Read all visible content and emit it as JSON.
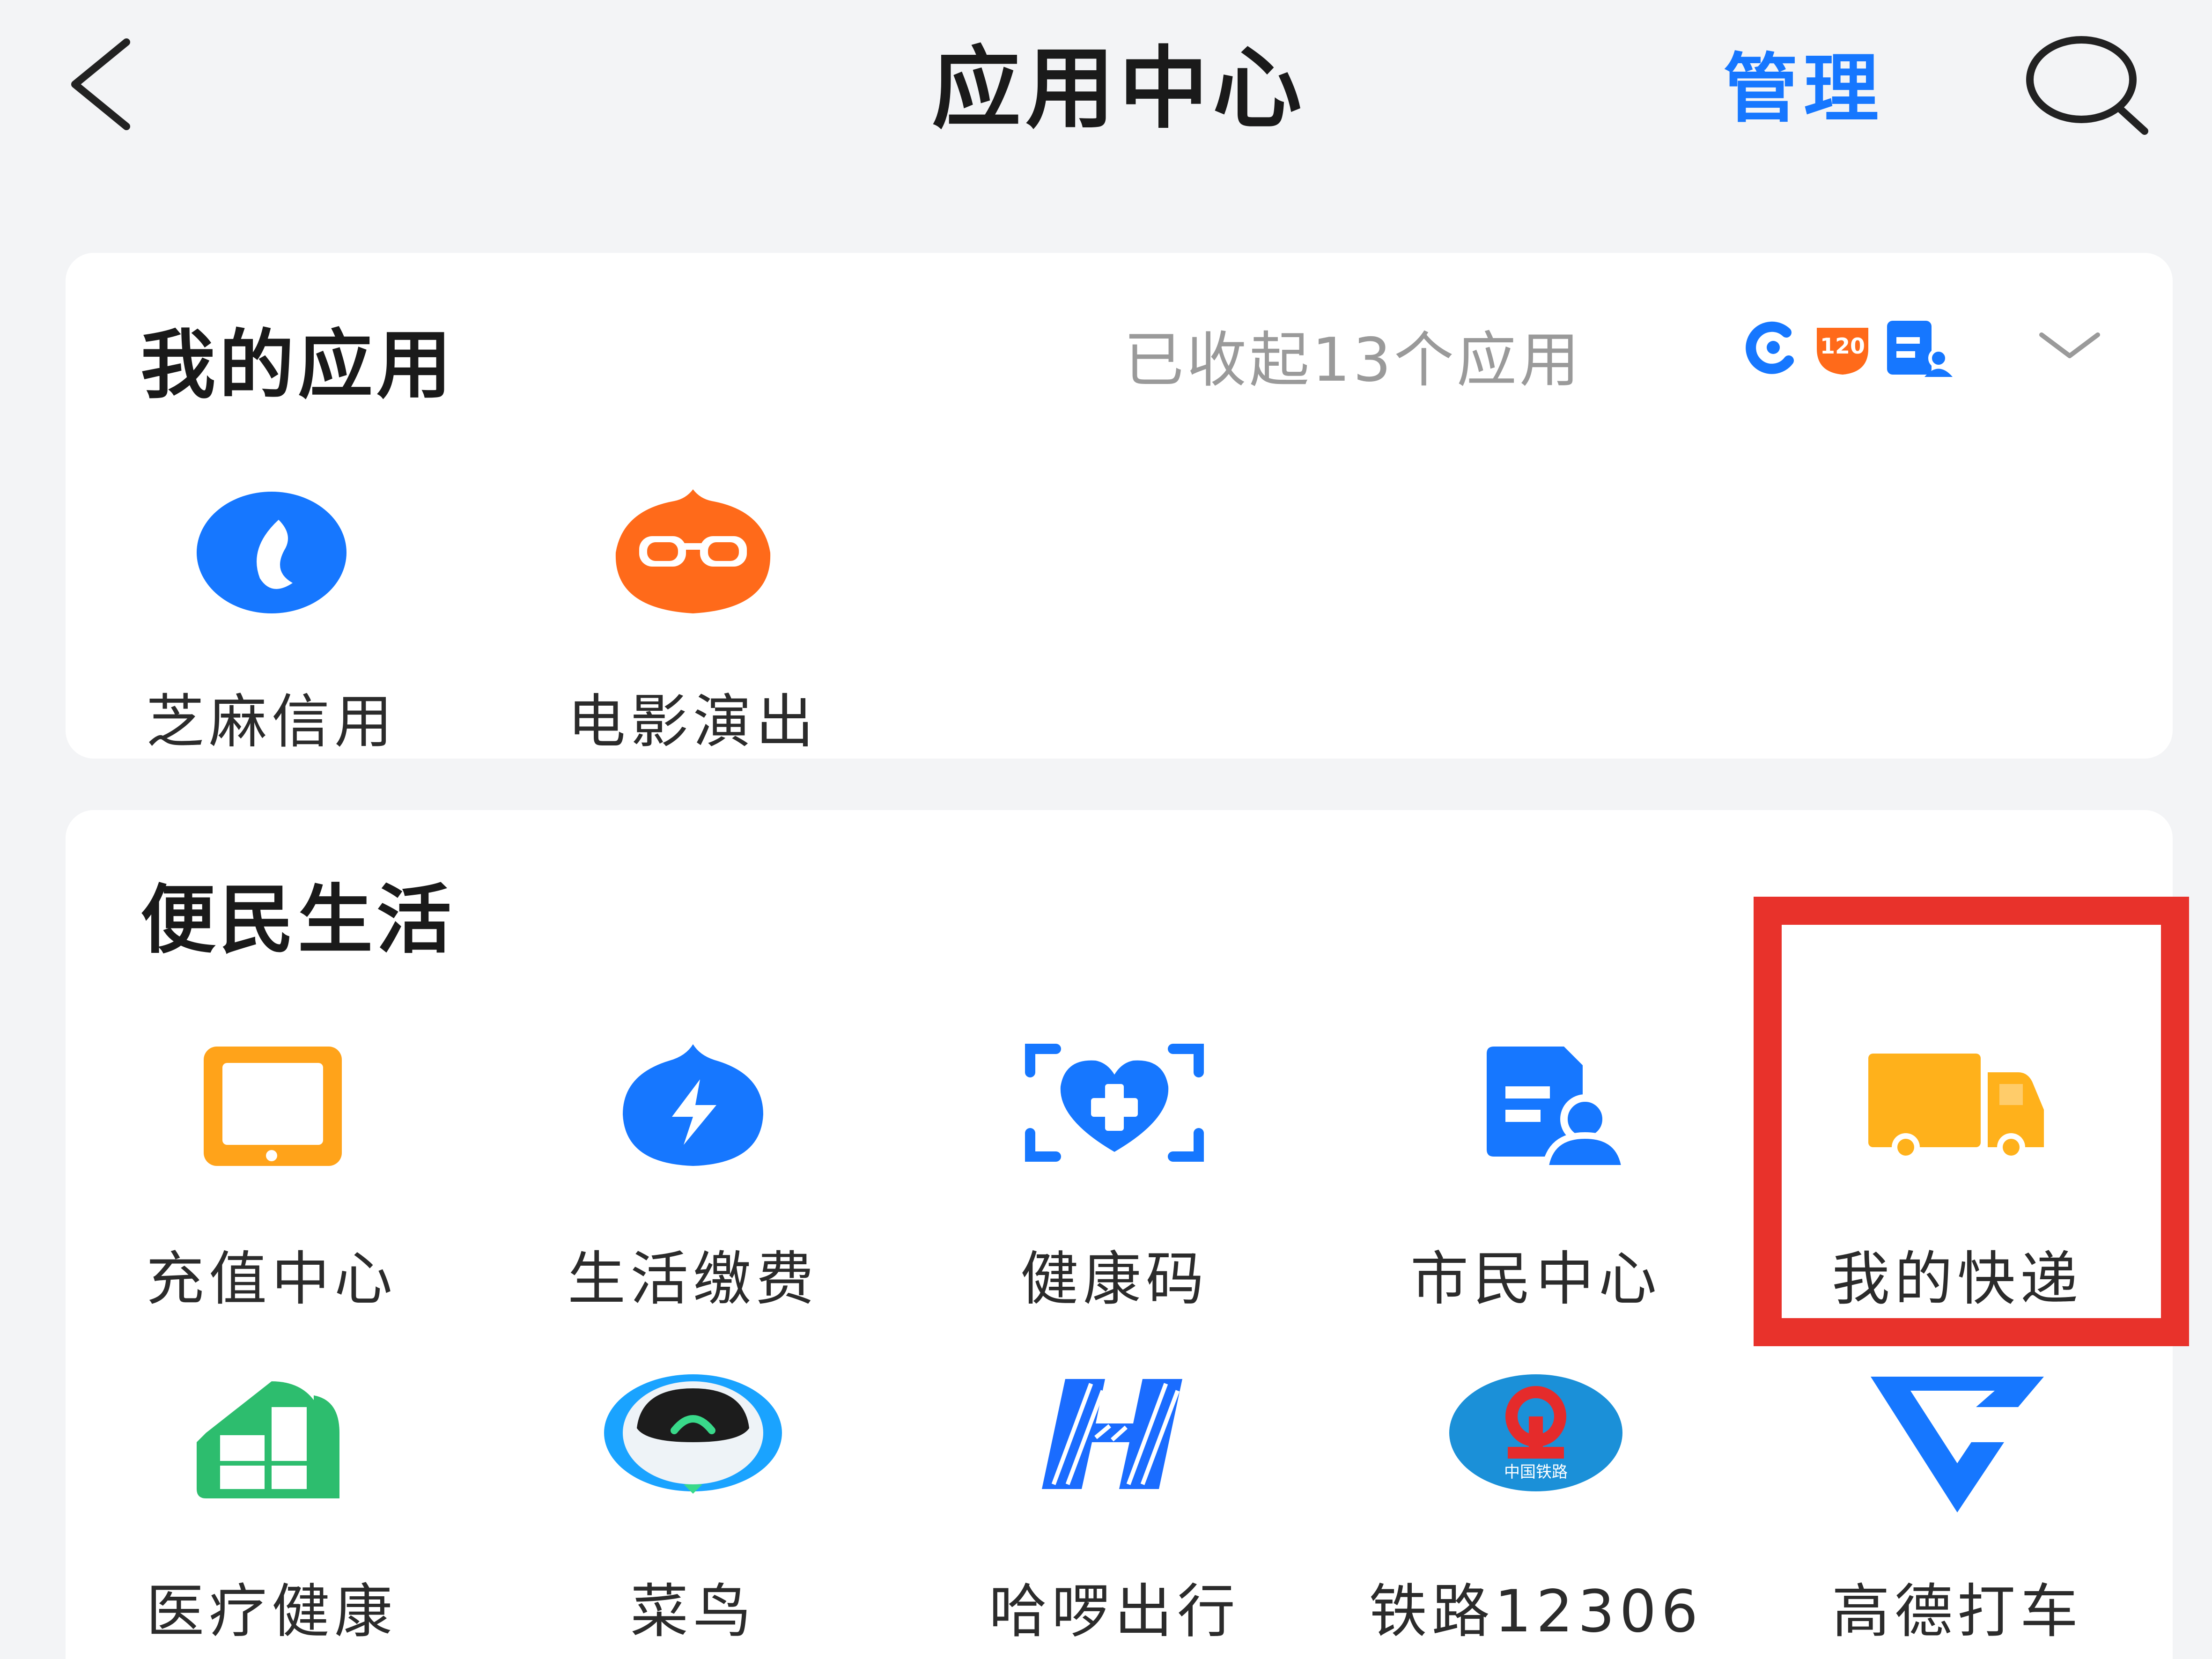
{
  "header": {
    "title": "应用中心",
    "manage_label": "管理"
  },
  "my_apps": {
    "title": "我的应用",
    "collapsed_text": "已收起13个应用",
    "preview_icons": [
      "alipay-c-icon",
      "ticket-120-icon",
      "citizen-card-icon"
    ],
    "apps": [
      {
        "label": "芝麻信用",
        "icon": "sesame-credit-icon"
      },
      {
        "label": "电影演出",
        "icon": "movie-glasses-icon"
      }
    ]
  },
  "convenience": {
    "title": "便民生活",
    "apps": [
      {
        "label": "充值中心",
        "icon": "phone-topup-icon"
      },
      {
        "label": "生活缴费",
        "icon": "bolt-drop-icon"
      },
      {
        "label": "健康码",
        "icon": "health-heart-icon"
      },
      {
        "label": "市民中心",
        "icon": "citizen-center-icon"
      },
      {
        "label": "我的快递",
        "icon": "delivery-truck-icon"
      },
      {
        "label": "医疗健康",
        "icon": "medical-house-icon"
      },
      {
        "label": "菜鸟",
        "icon": "cainiao-bird-icon"
      },
      {
        "label": "哈啰出行",
        "icon": "hello-h-icon"
      },
      {
        "label": "铁路12306",
        "icon": "railway-logo-icon"
      },
      {
        "label": "高德打车",
        "icon": "amap-arrow-icon"
      }
    ],
    "railway_logo_text": "中国铁路",
    "ticket_badge_text": "120"
  },
  "colors": {
    "accent": "#1677ff",
    "highlight_box": "#e8322b",
    "orange": "#ff6a1a",
    "truck": "#ffb11b",
    "green": "#2dbd6e"
  }
}
